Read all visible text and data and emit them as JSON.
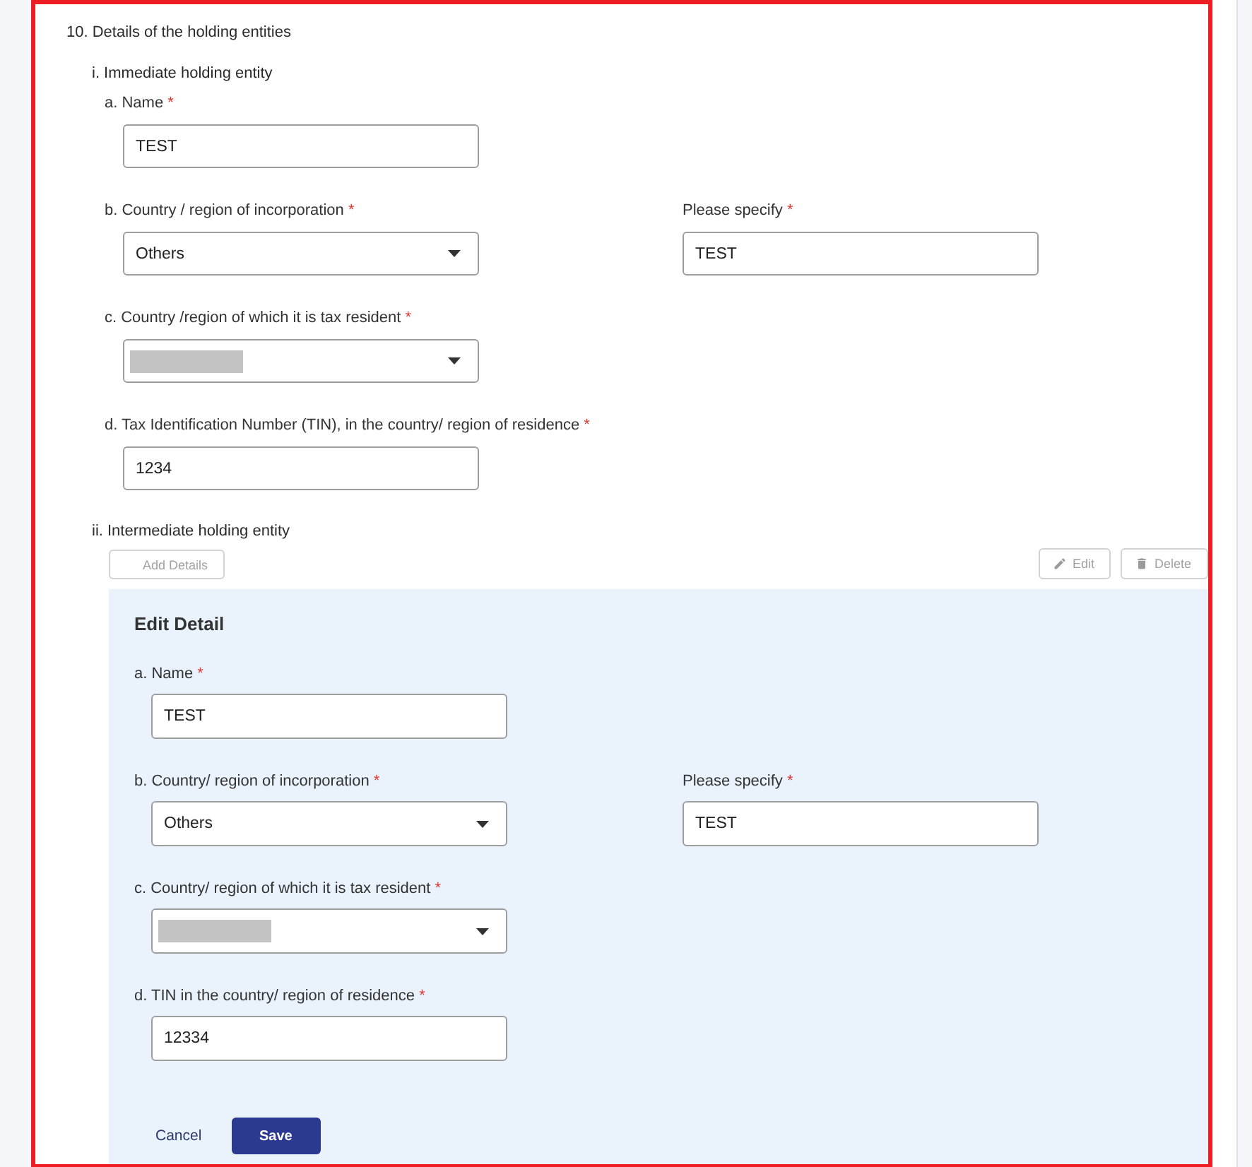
{
  "section": {
    "title": "10. Details of the holding entities"
  },
  "immediate_entity": {
    "title": "i. Immediate holding entity",
    "rows": [
      {
        "fields": [
          {
            "kind": "text",
            "label": "a. Name",
            "required_mark": "*",
            "value": "TEST",
            "redacted": false
          }
        ]
      },
      {
        "fields": [
          {
            "kind": "select",
            "label": "b. Country / region of incorporation",
            "required_mark": "*",
            "value": "Others",
            "redacted": false
          },
          {
            "kind": "text",
            "label": "Please specify",
            "required_mark": "*",
            "value": "TEST",
            "redacted": false
          }
        ]
      },
      {
        "fields": [
          {
            "kind": "select",
            "label": "c. Country /region of which it is tax resident",
            "required_mark": "*",
            "redacted": true
          }
        ]
      },
      {
        "fields": [
          {
            "kind": "text",
            "label": "d. Tax Identification Number (TIN), in the country/ region of residence",
            "required_mark": "*",
            "value": "1234",
            "redacted": false
          }
        ]
      }
    ]
  },
  "intermediate_entity": {
    "title": "ii. Intermediate holding entity",
    "toolbar": [
      {
        "kind": "add",
        "label": "Add Details",
        "disabled": true
      },
      {
        "kind": "edit",
        "label": "Edit",
        "disabled": true
      },
      {
        "kind": "delete",
        "label": "Delete",
        "disabled": true
      }
    ],
    "edit_panel": {
      "title": "Edit Detail",
      "rows": [
        {
          "fields": [
            {
              "kind": "text",
              "label": "a. Name",
              "required_mark": "*",
              "value": "TEST",
              "redacted": false
            }
          ]
        },
        {
          "fields": [
            {
              "kind": "select",
              "label": "b. Country/ region of incorporation",
              "required_mark": "*",
              "value": "Others",
              "redacted": false
            },
            {
              "kind": "text",
              "label": "Please specify",
              "required_mark": "*",
              "value": "TEST",
              "redacted": false
            }
          ]
        },
        {
          "fields": [
            {
              "kind": "select",
              "label": "c. Country/ region of which it is tax resident",
              "required_mark": "*",
              "redacted": true
            }
          ]
        },
        {
          "fields": [
            {
              "kind": "text",
              "label": "d. TIN in the country/ region of residence",
              "required_mark": "*",
              "value": "12334",
              "redacted": false
            }
          ]
        }
      ],
      "actions": [
        {
          "kind": "cancel",
          "label": "Cancel"
        },
        {
          "kind": "save",
          "label": "Save"
        }
      ]
    }
  }
}
